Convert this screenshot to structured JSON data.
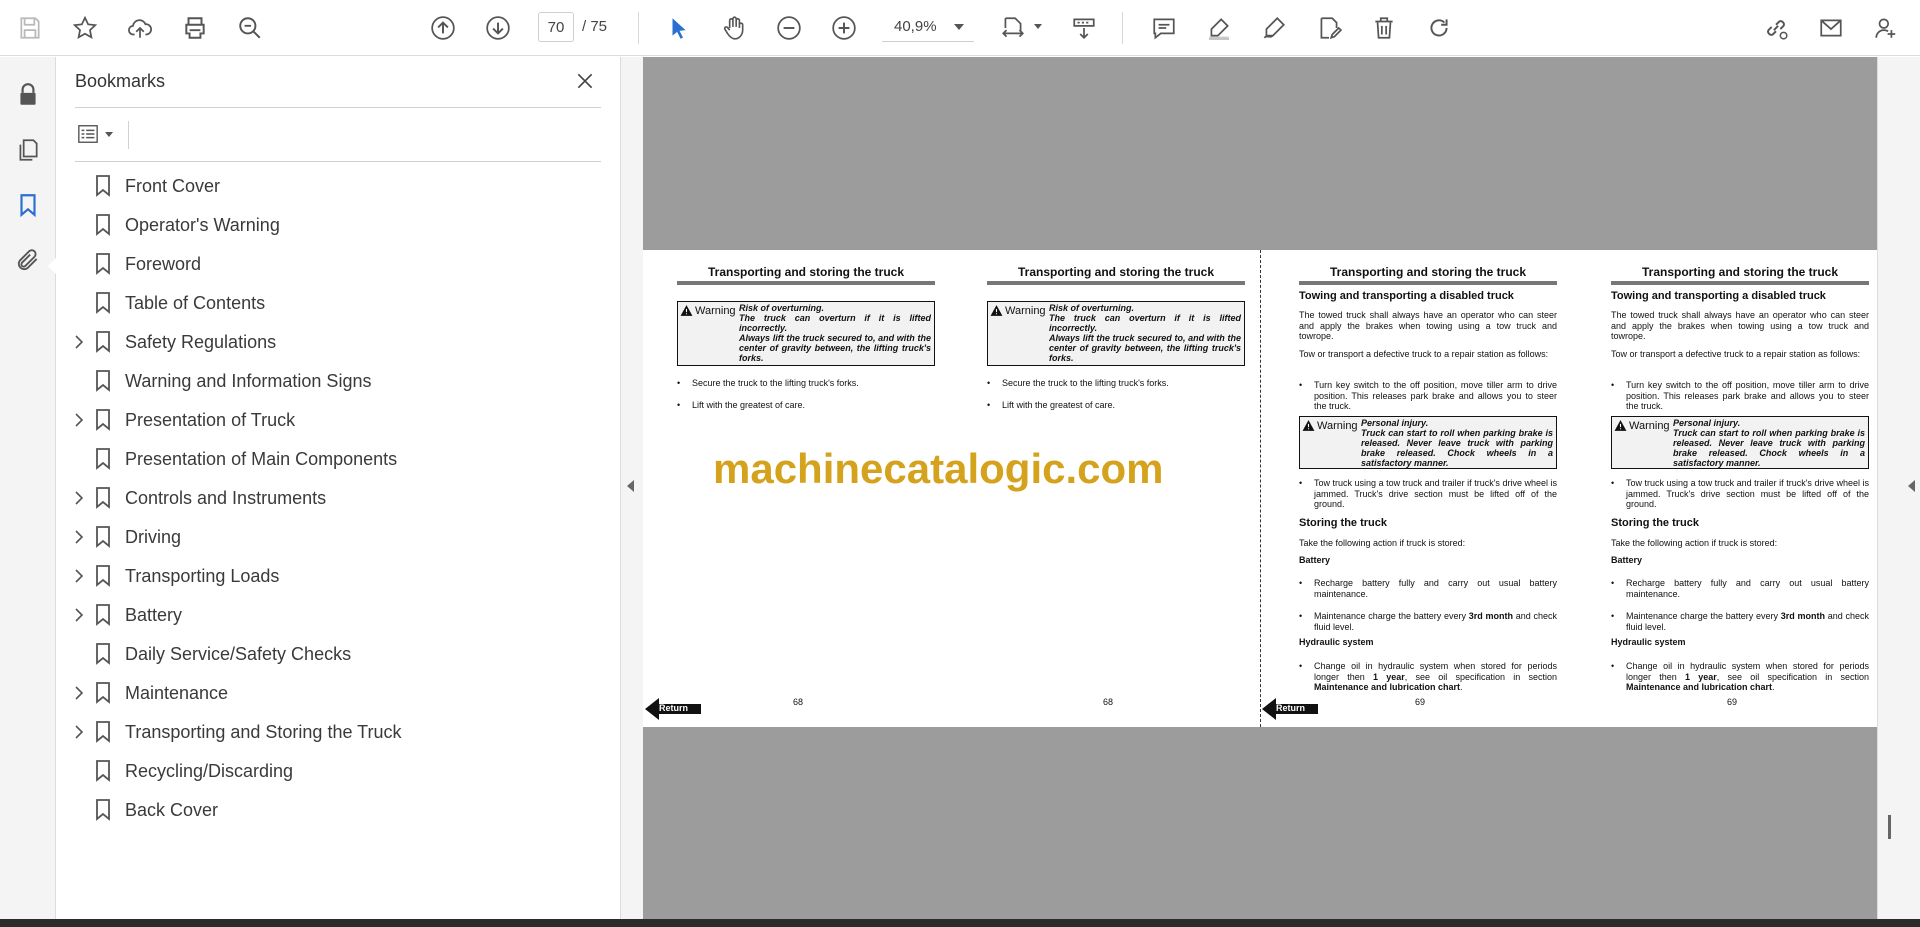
{
  "toolbar": {
    "page_current": "70",
    "page_total": "/ 75",
    "zoom": "40,9%"
  },
  "bookmarks": {
    "title": "Bookmarks",
    "items": [
      {
        "label": "Front Cover",
        "expandable": false
      },
      {
        "label": "Operator's Warning",
        "expandable": false
      },
      {
        "label": "Foreword",
        "expandable": false
      },
      {
        "label": "Table of Contents",
        "expandable": false
      },
      {
        "label": "Safety Regulations",
        "expandable": true
      },
      {
        "label": "Warning and Information Signs",
        "expandable": false
      },
      {
        "label": "Presentation of Truck",
        "expandable": true
      },
      {
        "label": "Presentation of Main Components",
        "expandable": false
      },
      {
        "label": "Controls and Instruments",
        "expandable": true
      },
      {
        "label": "Driving",
        "expandable": true
      },
      {
        "label": "Transporting Loads",
        "expandable": true
      },
      {
        "label": "Battery",
        "expandable": true
      },
      {
        "label": "Daily Service/Safety Checks",
        "expandable": false
      },
      {
        "label": "Maintenance",
        "expandable": true
      },
      {
        "label": "Transporting and Storing the Truck",
        "expandable": true
      },
      {
        "label": "Recycling/Discarding",
        "expandable": false
      },
      {
        "label": "Back Cover",
        "expandable": false
      }
    ]
  },
  "document": {
    "watermark": "machinecatalogic.com",
    "return_label": "Return",
    "left_pages": {
      "heading": "Transporting and storing the truck",
      "warning_label": "Warning",
      "warning_line1": "Risk of overturning.",
      "warning_line2": "The truck can overturn if it is lifted incorrectly.",
      "warning_line3": "Always lift the truck secured to, and with the center of gravity between, the lifting truck's forks.",
      "bullet1": "Secure the truck to the lifting truck's forks.",
      "bullet2": "Lift with the greatest of care.",
      "page_number": "68"
    },
    "right_pages": {
      "heading": "Transporting and storing the truck",
      "subheading": "Towing and transporting a disabled truck",
      "para1": "The towed truck shall always have an operator who can steer and apply the brakes when towing using a tow truck and towrope.",
      "para2": "Tow or transport a defective truck to a repair station as follows:",
      "bullet1": "Turn key switch to the off position, move tiller arm to drive position. This releases park brake and allows you to steer the truck.",
      "warning_label": "Warning",
      "warning_line1": "Personal injury.",
      "warning_line2": "Truck can start to roll when parking brake is released. Never leave truck with parking brake released. Chock wheels in a satisfactory manner.",
      "bullet2": "Tow truck using a tow truck and trailer if truck's drive wheel is jammed. Truck's drive section must be lifted off of the ground.",
      "storing_head": "Storing the truck",
      "storing_para": "Take the following action if truck is stored:",
      "battery_head": "Battery",
      "battery_b1": "Recharge battery fully and carry out usual battery maintenance.",
      "battery_b2_pre": "Maintenance charge the battery every ",
      "battery_b2_bold": "3rd month",
      "battery_b2_post": " and check fluid level.",
      "hydraulic_head": "Hydraulic system",
      "hydraulic_b1_pre": "Change oil in hydraulic system when stored for periods longer then ",
      "hydraulic_b1_bold": "1 year",
      "hydraulic_b1_mid": ", see oil specification in section ",
      "hydraulic_b1_bold2": "Maintenance and lubrication chart",
      "hydraulic_b1_post": ".",
      "page_number": "69"
    }
  }
}
